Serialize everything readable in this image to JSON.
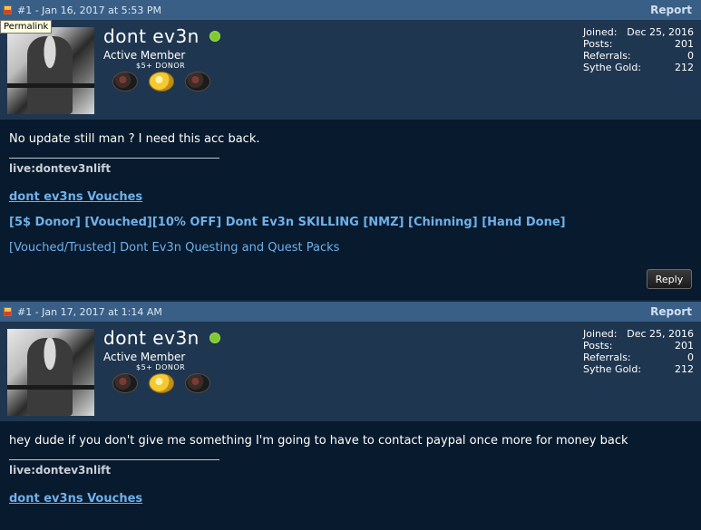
{
  "posts": [
    {
      "header": "#1 - Jan 16, 2017 at 5:53 PM",
      "report": "Report",
      "username": "dont ev3n",
      "usertitle": "Active Member",
      "donor": "$5+ DONOR",
      "stats": {
        "joined_label": "Joined:",
        "joined": "Dec 25, 2016",
        "posts_label": "Posts:",
        "posts": "201",
        "referrals_label": "Referrals:",
        "referrals": "0",
        "gold_label": "Sythe Gold:",
        "gold": "212"
      },
      "message": "No update still man ? I need this acc back.",
      "sig_live": "live:dontev3nlift",
      "sig_link": "dont ev3ns Vouches",
      "sig_line2": "[5$ Donor] [Vouched][10% OFF] Dont Ev3n SKILLING [NMZ] [Chinning] [Hand Done]",
      "sig_line3": "[Vouched/Trusted] Dont Ev3n Questing and Quest Packs",
      "reply": "Reply"
    },
    {
      "header": "#1 - Jan 17, 2017 at 1:14 AM",
      "report": "Report",
      "username": "dont ev3n",
      "usertitle": "Active Member",
      "donor": "$5+ DONOR",
      "stats": {
        "joined_label": "Joined:",
        "joined": "Dec 25, 2016",
        "posts_label": "Posts:",
        "posts": "201",
        "referrals_label": "Referrals:",
        "referrals": "0",
        "gold_label": "Sythe Gold:",
        "gold": "212"
      },
      "message": "hey dude if you don't give me something I'm going to have to contact paypal once more for money back",
      "sig_live": "live:dontev3nlift",
      "sig_link": "dont ev3ns Vouches"
    }
  ],
  "tooltip": "Permalink",
  "colors": {
    "header": "#3a5f86",
    "userbar": "#1f3650",
    "body": "#081a2d",
    "link": "#6fb0ea",
    "online": "#7fca2e"
  }
}
